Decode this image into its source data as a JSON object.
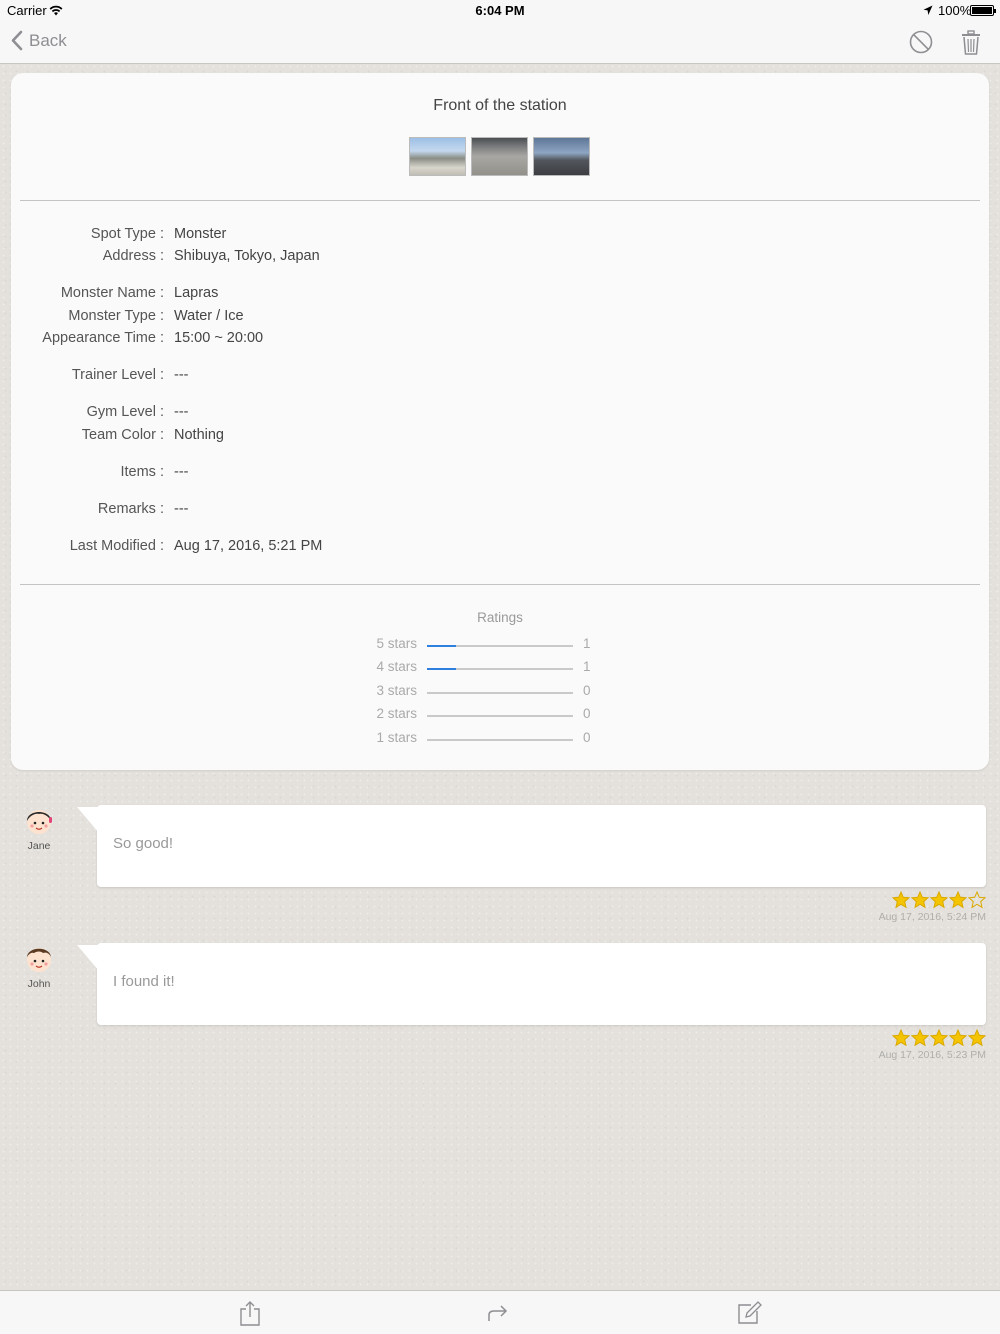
{
  "status_bar": {
    "carrier": "Carrier",
    "time": "6:04 PM",
    "battery": "100%",
    "icons": [
      "wifi-icon",
      "location-arrow-icon",
      "battery-icon"
    ]
  },
  "nav": {
    "back_label": "Back",
    "right_icons": [
      "block-icon",
      "trash-icon"
    ]
  },
  "spot": {
    "title": "Front of the station",
    "photos": [
      "photo-1",
      "photo-2",
      "photo-3"
    ],
    "details": [
      {
        "label": "Spot Type :",
        "value": "Monster"
      },
      {
        "label": "Address :",
        "value": "Shibuya, Tokyo, Japan"
      },
      {
        "label": "Monster Name :",
        "value": "Lapras"
      },
      {
        "label": "Monster Type :",
        "value": "Water / Ice"
      },
      {
        "label": "Appearance Time :",
        "value": "15:00 ~ 20:00"
      },
      {
        "label": "Trainer Level :",
        "value": "---"
      },
      {
        "label": "Gym Level :",
        "value": "---"
      },
      {
        "label": "Team Color :",
        "value": "Nothing"
      },
      {
        "label": "Items :",
        "value": "---"
      },
      {
        "label": "Remarks :",
        "value": "---"
      },
      {
        "label": "Last Modified :",
        "value": "Aug 17, 2016, 5:21 PM"
      }
    ]
  },
  "ratings": {
    "title": "Ratings",
    "rows": [
      {
        "label": "5 stars",
        "count": "1",
        "fraction": 0.2
      },
      {
        "label": "4 stars",
        "count": "1",
        "fraction": 0.2
      },
      {
        "label": "3 stars",
        "count": "0",
        "fraction": 0
      },
      {
        "label": "2 stars",
        "count": "0",
        "fraction": 0
      },
      {
        "label": "1 stars",
        "count": "0",
        "fraction": 0
      }
    ],
    "accent_color": "#2f80de"
  },
  "comments": [
    {
      "user": "Jane",
      "text": "So good!",
      "stars": 4,
      "timestamp": "Aug 17, 2016, 5:24 PM"
    },
    {
      "user": "John",
      "text": "I found it!",
      "stars": 5,
      "timestamp": "Aug 17, 2016, 5:23 PM"
    }
  ],
  "toolbar": {
    "icons": [
      "share-icon",
      "forward-icon",
      "compose-icon"
    ]
  },
  "colors": {
    "star": "#f5c400",
    "star_outline": "#d9a900",
    "background": "#e4e1dc"
  }
}
